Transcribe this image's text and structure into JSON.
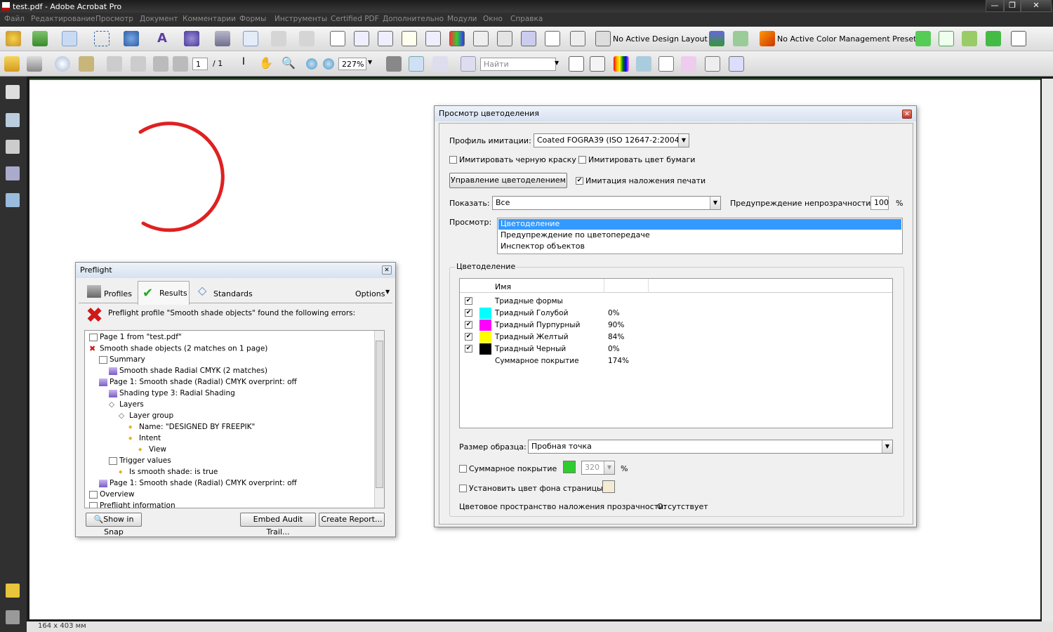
{
  "titlebar": {
    "title": "test.pdf - Adobe Acrobat Pro",
    "minimize": "—",
    "maximize": "❐",
    "close": "✕"
  },
  "menu": [
    "Файл",
    "Редактирование",
    "Просмотр",
    "Документ",
    "Комментарии",
    "Формы",
    "Инструменты",
    "Certified PDF",
    "Дополнительно",
    "Модули",
    "Окно",
    "Справка"
  ],
  "toolbar1": {
    "design_layout": "No Active Design Layout",
    "color_preset": "No Active Color Management Preset"
  },
  "toolbar2": {
    "page_current": "1",
    "page_total": "/ 1",
    "zoom": "227%",
    "search_placeholder": "Найти"
  },
  "statusbar": {
    "page_size": "164 x 403 мм"
  },
  "preflight": {
    "title": "Preflight",
    "tabs": {
      "profiles": "Profiles",
      "results": "Results",
      "standards": "Standards"
    },
    "options": "Options",
    "error_message": "Preflight profile \"Smooth shade objects\" found the following errors:",
    "tree": [
      {
        "text": "Page 1 from \"test.pdf\"",
        "level": 0
      },
      {
        "text": "Smooth shade objects (2 matches on 1 page)",
        "level": 0
      },
      {
        "text": "Summary",
        "level": 1
      },
      {
        "text": "Smooth shade Radial CMYK (2 matches)",
        "level": 2
      },
      {
        "text": "Page 1: Smooth shade (Radial) CMYK  overprint: off",
        "level": 1
      },
      {
        "text": "Shading type 3: Radial Shading",
        "level": 2
      },
      {
        "text": "Layers",
        "level": 2
      },
      {
        "text": "Layer group",
        "level": 3
      },
      {
        "text": "Name: \"DESIGNED BY FREEPIK\"",
        "level": 4
      },
      {
        "text": "Intent",
        "level": 4
      },
      {
        "text": "View",
        "level": 5
      },
      {
        "text": "Trigger values",
        "level": 2
      },
      {
        "text": "Is smooth shade: is true",
        "level": 3
      },
      {
        "text": "Page 1: Smooth shade (Radial) CMYK  overprint: off",
        "level": 1
      },
      {
        "text": "Overview",
        "level": 0
      },
      {
        "text": "Preflight information",
        "level": 0
      }
    ],
    "buttons": {
      "show_in_snap": "Show in Snap",
      "embed_audit": "Embed Audit Trail...",
      "create_report": "Create Report..."
    }
  },
  "separation": {
    "title": "Просмотр цветоделения",
    "profile_label": "Профиль имитации:",
    "profile_value": "Coated FOGRA39 (ISO 12647-2:2004)",
    "simulate_black": "Имитировать черную краску",
    "simulate_paper": "Имитировать цвет бумаги",
    "manage_button": "Управление цветоделением",
    "simulate_overprint": "Имитация наложения печати",
    "show_label": "Показать:",
    "show_value": "Все",
    "opacity_label": "Предупреждение непрозрачности:",
    "opacity_value": "100",
    "opacity_unit": "%",
    "preview_label": "Просмотр:",
    "preview_options": [
      "Цветоделение",
      "Предупреждение по цветопередаче",
      "Инспектор объектов"
    ],
    "group_title": "Цветоделение",
    "table_header": "Имя",
    "plates": [
      {
        "name": "Триадные формы",
        "value": "",
        "color": ""
      },
      {
        "name": "Триадный Голубой",
        "value": "0%",
        "color": "#00ffff"
      },
      {
        "name": "Триадный Пурпурный",
        "value": "90%",
        "color": "#ff00ff"
      },
      {
        "name": "Триадный Желтый",
        "value": "84%",
        "color": "#ffff00"
      },
      {
        "name": "Триадный Черный",
        "value": "0%",
        "color": "#000000"
      },
      {
        "name": "Суммарное покрытие",
        "value": "174%",
        "color": ""
      }
    ],
    "sample_label": "Размер образца:",
    "sample_value": "Пробная точка",
    "total_coverage": "Суммарное покрытие",
    "coverage_value": "320",
    "coverage_unit": "%",
    "page_bg": "Установить цвет фона страницы",
    "blend_label": "Цветовое пространство наложения прозрачности:",
    "blend_value": "Отсутствует"
  }
}
